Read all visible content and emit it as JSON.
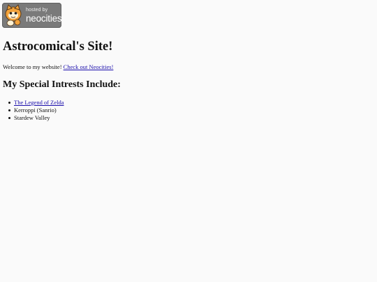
{
  "badge": {
    "small_text": "hosted by",
    "big_text": "neocities",
    "icon": "cat-mascot-icon"
  },
  "page": {
    "title": "Astrocomical's Site!",
    "welcome_text": "Welcome to my website! ",
    "welcome_link": "Check out Neocities!",
    "interests_heading": "My Special Intrests Include:",
    "interests": [
      "The Legend of Zelda",
      "Kerroppi (Sanrio)",
      "Stardew Valley"
    ]
  },
  "colors": {
    "background": "#fafafa",
    "link": "#1a0dab",
    "badge_bg": "#7a7a7a",
    "mascot_orange": "#f2a23a"
  }
}
